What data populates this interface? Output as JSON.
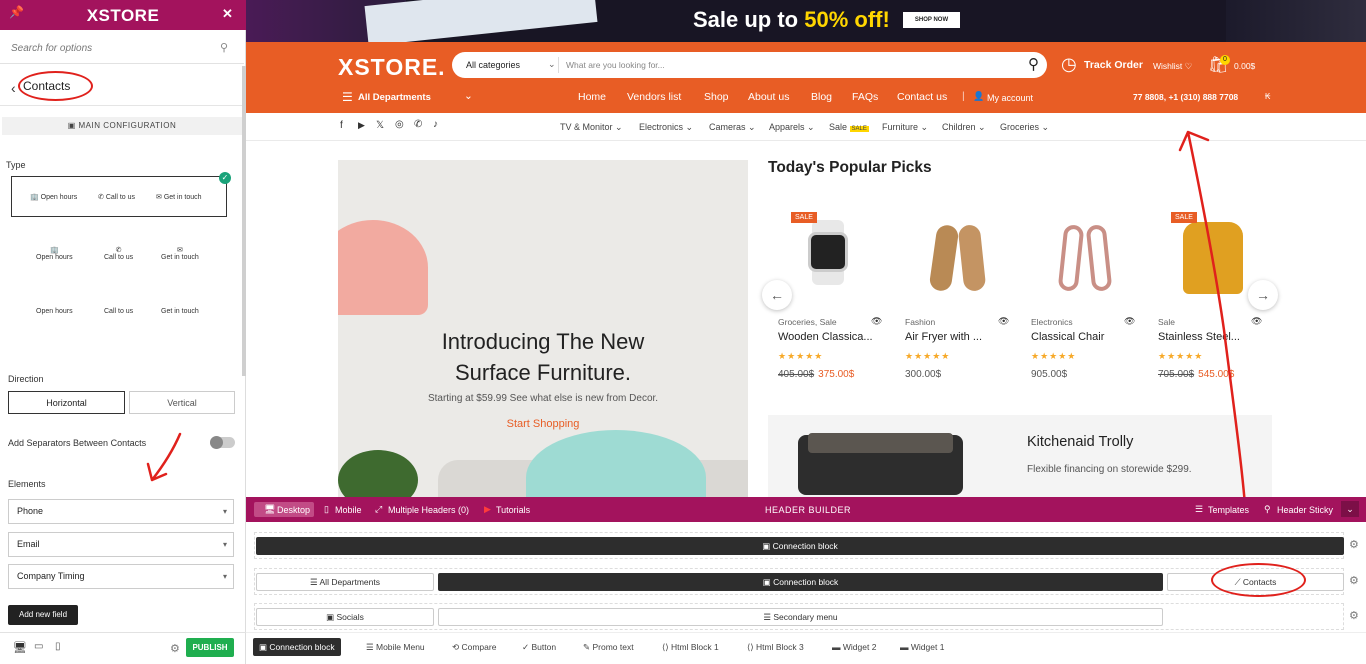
{
  "sidebar": {
    "brand": "XSTORE",
    "search_placeholder": "Search for options",
    "back_title": "Contacts",
    "section_header": "MAIN CONFIGURATION",
    "type_label": "Type",
    "type_options": [
      "Open hours",
      "Call to us",
      "Get in touch"
    ],
    "direction_label": "Direction",
    "direction_options": [
      "Horizontal",
      "Vertical"
    ],
    "separators_label": "Add Separators Between Contacts",
    "elements_label": "Elements",
    "elements": [
      "Phone",
      "Email",
      "Company Timing"
    ],
    "add_field_label": "Add new field",
    "publish_label": "PUBLISH"
  },
  "banner": {
    "text_prefix": "Sale up to ",
    "text_highlight": "50% off!",
    "shop_now": "SHOP NOW"
  },
  "header": {
    "logo": "XSTORE.",
    "search_category": "All categories",
    "search_placeholder": "What are you looking for...",
    "track_order": "Track Order",
    "wishlist": "Wishlist",
    "cart_count": "0",
    "cart_total": "0.00$",
    "all_departments": "All Departments",
    "nav": [
      "Home",
      "Vendors list",
      "Shop",
      "About us",
      "Blog",
      "FAQs",
      "Contact us"
    ],
    "account": "My account",
    "phones": "77 8808, +1 (310) 888 7708"
  },
  "categories": [
    "TV & Monitor",
    "Electronics",
    "Cameras",
    "Apparels",
    "Sale",
    "Furniture",
    "Children",
    "Groceries"
  ],
  "sale_badge": "SALE",
  "hero": {
    "title": "Introducing The New Surface Furniture.",
    "subtitle": "Starting at $59.99 See what else is new from Decor.",
    "cta": "Start Shopping"
  },
  "picks": {
    "title": "Today's Popular Picks",
    "products": [
      {
        "category": "Groceries, Sale",
        "name": "Wooden Classica...",
        "stars": "★★★★★",
        "old_price": "405.00$",
        "price": "375.00$",
        "sale": "SALE"
      },
      {
        "category": "Fashion",
        "name": "Air Fryer with ...",
        "stars": "★★★★★",
        "old_price": "",
        "price": "300.00$",
        "sale": ""
      },
      {
        "category": "Electronics",
        "name": "Classical Chair",
        "stars": "★★★★★",
        "old_price": "",
        "price": "905.00$",
        "sale": ""
      },
      {
        "category": "Sale",
        "name": "Stainless Steel...",
        "stars": "★★★★★",
        "old_price": "705.00$",
        "price": "545.00$",
        "sale": "SALE"
      }
    ]
  },
  "promo": {
    "title": "Kitchenaid Trolly",
    "subtitle": "Flexible financing on storewide $299."
  },
  "builder": {
    "devices": [
      "Desktop",
      "Mobile"
    ],
    "multiple_headers": "Multiple Headers (0)",
    "tutorials": "Tutorials",
    "title": "HEADER BUILDER",
    "templates": "Templates",
    "sticky": "Header Sticky",
    "row1_block": "Connection block",
    "row2_left": "All Departments",
    "row2_center": "Connection block",
    "row2_right": "Contacts",
    "row3_left": "Socials",
    "row3_center": "Secondary menu",
    "unused": [
      "Connection block",
      "Mobile Menu",
      "Compare",
      "Button",
      "Promo text",
      "Html Block 1",
      "Html Block 3",
      "Widget 2",
      "Widget 1"
    ]
  },
  "colors": {
    "brand_magenta": "#a3135d",
    "header_orange": "#e85d25",
    "publish_green": "#1fae4f",
    "annotation_red": "#e0211c"
  }
}
